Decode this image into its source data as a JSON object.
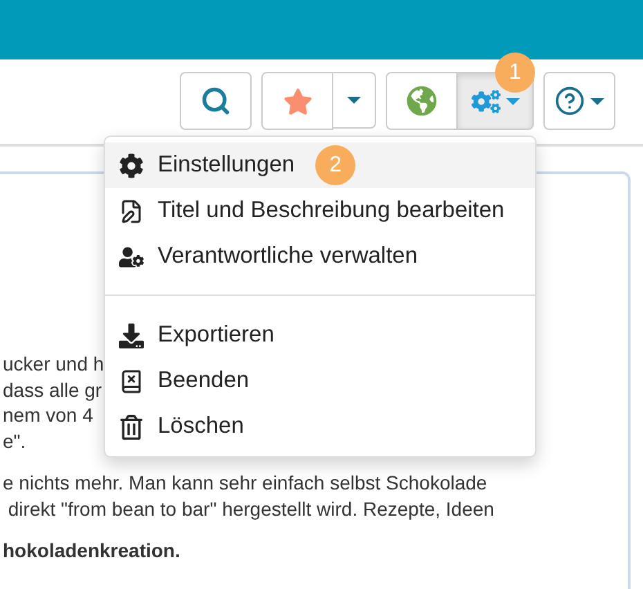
{
  "toolbar": [
    {
      "kind": "search",
      "selected": false
    },
    {
      "kind": "star",
      "selected": false
    },
    {
      "kind": "globe",
      "selected": false
    },
    {
      "kind": "gears",
      "selected": true,
      "badge": "1"
    },
    {
      "kind": "help",
      "selected": false
    }
  ],
  "paragraphs": [
    {
      "lines": [
        {
          "text": "ucker und h",
          "bold": false
        },
        {
          "text": "dass alle gr",
          "bold": false
        },
        {
          "text": "nem von 4",
          "bold": false
        },
        {
          "text": "e\".",
          "bold": false
        }
      ]
    },
    {
      "lines": [
        {
          "text": "e nichts mehr. Man kann sehr einfach selbst Schokolade",
          "bold": false
        },
        {
          "text": " direkt \"from bean to bar\" hergestellt wird. Rezepte, Ideen",
          "bold": false
        }
      ]
    },
    {
      "lines": [
        {
          "text": "hokoladenkreation.",
          "bold": true
        }
      ]
    }
  ],
  "menu": [
    {
      "kind": "settings",
      "label": "Einstellungen",
      "selected": true,
      "badge": "2"
    },
    {
      "kind": "edit",
      "label": "Titel und Beschreibung bearbeiten",
      "selected": false
    },
    {
      "kind": "owners",
      "label": "Verantwortliche verwalten",
      "selected": false
    },
    {
      "kind": "divider"
    },
    {
      "kind": "export",
      "label": "Exportieren",
      "selected": false
    },
    {
      "kind": "close",
      "label": "Beenden",
      "selected": false
    },
    {
      "kind": "delete",
      "label": "Löschen",
      "selected": false
    }
  ]
}
